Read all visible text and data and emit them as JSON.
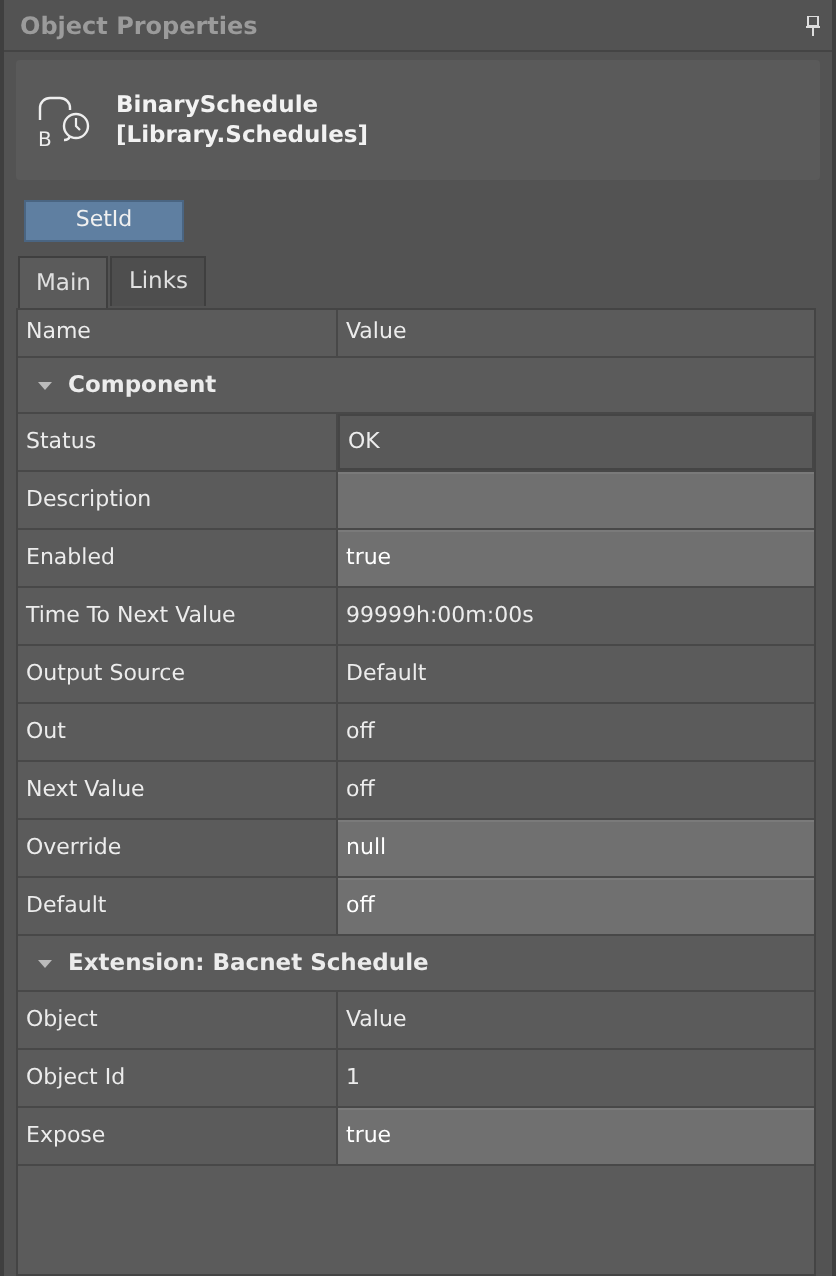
{
  "panel": {
    "title": "Object Properties",
    "pinned": true
  },
  "object": {
    "icon_letter": "B",
    "name": "BinarySchedule",
    "library": "[Library.Schedules]"
  },
  "buttons": [
    "SetId"
  ],
  "tabs": [
    {
      "label": "Main",
      "selected": true
    },
    {
      "label": "Links",
      "selected": false
    }
  ],
  "table": {
    "columns": [
      "Name",
      "Value"
    ],
    "sections": [
      {
        "title": "Component",
        "expanded": true,
        "rows": [
          {
            "kind": "property",
            "name": "Status",
            "value": "OK",
            "editable": false,
            "selected": true
          },
          {
            "kind": "property",
            "name": "Description",
            "value": "",
            "editable": true,
            "selected": false
          },
          {
            "kind": "property",
            "name": "Enabled",
            "value": "true",
            "editable": true,
            "selected": false
          },
          {
            "kind": "property",
            "name": "Time To Next Value",
            "value": "99999h:00m:00s",
            "editable": false,
            "selected": false
          },
          {
            "kind": "property",
            "name": "Output Source",
            "value": "Default",
            "editable": false,
            "selected": false
          },
          {
            "kind": "property",
            "name": "Out",
            "value": "off",
            "editable": false,
            "selected": false
          },
          {
            "kind": "property",
            "name": "Next Value",
            "value": "off",
            "editable": false,
            "selected": false
          },
          {
            "kind": "property",
            "name": "Override",
            "value": "null",
            "editable": true,
            "selected": false
          },
          {
            "kind": "property",
            "name": "Default",
            "value": "off",
            "editable": true,
            "selected": false
          }
        ]
      },
      {
        "title": "Extension: Bacnet Schedule",
        "expanded": true,
        "rows": [
          {
            "kind": "header",
            "name": "Object",
            "value": "Value"
          },
          {
            "kind": "property",
            "name": "Object Id",
            "value": "1",
            "editable": false,
            "selected": false
          },
          {
            "kind": "property",
            "name": "Expose",
            "value": "true",
            "editable": true,
            "selected": false
          }
        ]
      }
    ]
  }
}
